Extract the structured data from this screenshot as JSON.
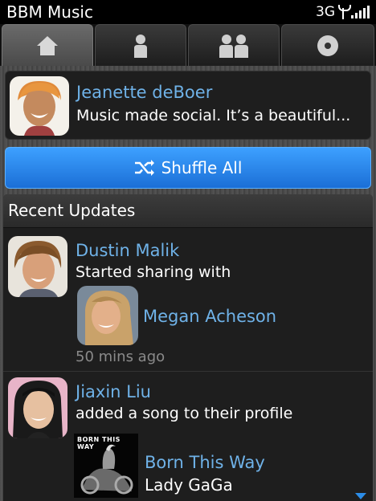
{
  "status_bar": {
    "app_title": "BBM Music",
    "network": "3G"
  },
  "tabs": [
    {
      "icon": "home-icon",
      "active": true
    },
    {
      "icon": "person-icon",
      "active": false
    },
    {
      "icon": "people-icon",
      "active": false
    },
    {
      "icon": "disc-icon",
      "active": false
    }
  ],
  "profile": {
    "name": "Jeanette deBoer",
    "status": "Music made social. It’s a beautiful..."
  },
  "shuffle_label": "Shuffle All",
  "recent_updates": {
    "title": "Recent Updates",
    "items": [
      {
        "name": "Dustin Malik",
        "action": "Started sharing with",
        "target": "Megan Acheson",
        "time": "50 mins ago"
      },
      {
        "name": "Jiaxin Liu",
        "action": "added a song to their profile",
        "song": "Born This Way",
        "artist": "Lady GaGa",
        "album_text": "BORN THIS WAY"
      }
    ]
  },
  "colors": {
    "accent": "#6fb2e8",
    "button": "#2a86ef"
  }
}
